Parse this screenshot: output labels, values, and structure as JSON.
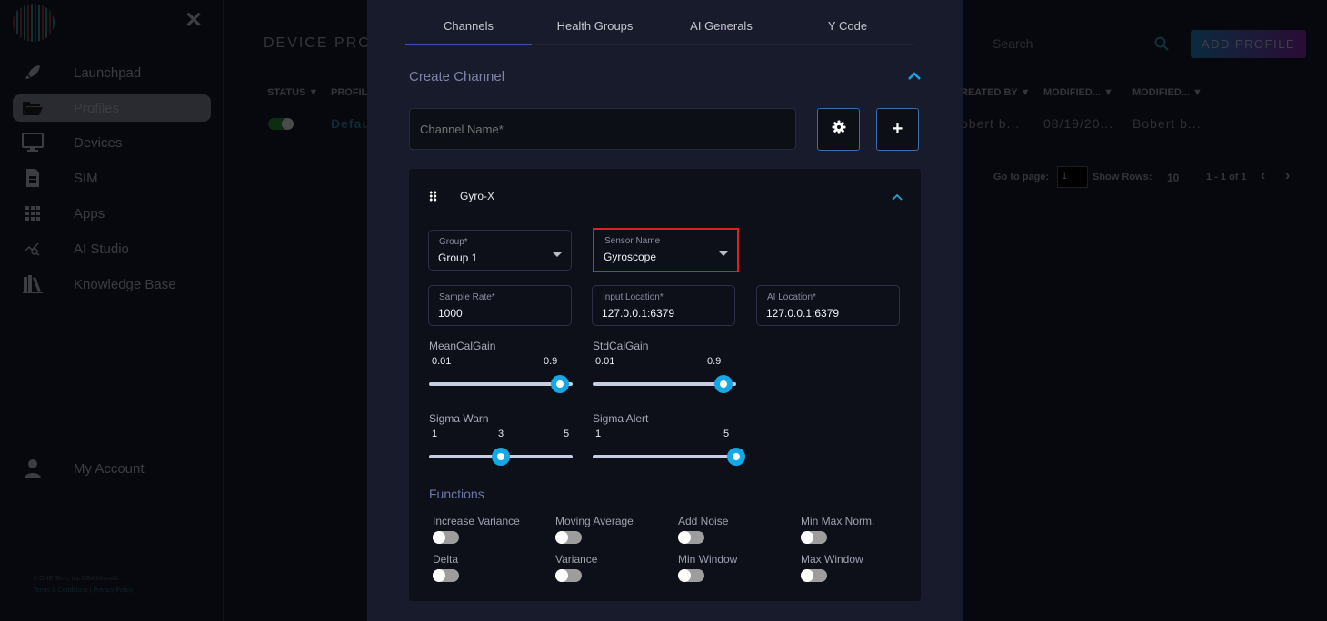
{
  "sidebar": {
    "items": [
      {
        "label": "Launchpad",
        "icon": "rocket-icon",
        "active": false
      },
      {
        "label": "Profiles",
        "icon": "folder-open-icon",
        "active": true
      },
      {
        "label": "Devices",
        "icon": "monitor-icon",
        "active": false
      },
      {
        "label": "SIM",
        "icon": "sim-card-icon",
        "active": false
      },
      {
        "label": "Apps",
        "icon": "grid-icon",
        "active": false
      },
      {
        "label": "AI Studio",
        "icon": "chart-search-icon",
        "active": false
      },
      {
        "label": "Knowledge Base",
        "icon": "books-icon",
        "active": false
      }
    ],
    "account": {
      "label": "My Account",
      "icon": "user-icon"
    },
    "footer": {
      "copyright": "© ONE Tech, Inc DBA MicroAI",
      "terms": "Terms & Conditions",
      "separator": "|",
      "privacy": "Privacy Policy"
    },
    "close_symbol": "✕"
  },
  "background_page": {
    "title": "DEVICE PRO",
    "columns": [
      "STATUS",
      "PROFIL",
      "REATED BY",
      "MODIFIED...",
      "MODIFIED..."
    ],
    "row": {
      "profile": "Defau",
      "created_by": "obert b...",
      "modified_date": "08/19/20...",
      "modified_by": "Bobert b..."
    },
    "search_placeholder": "Search",
    "add_profile": "ADD PROFILE",
    "pager": {
      "go_to_label": "Go to page:",
      "page_value": "1",
      "show_rows_label": "Show Rows:",
      "rows_value": "10",
      "range": "1 - 1 of 1",
      "prev": "‹",
      "next": "›"
    }
  },
  "modal": {
    "tabs": [
      {
        "label": "Channels",
        "active": true
      },
      {
        "label": "Health Groups",
        "active": false
      },
      {
        "label": "AI Generals",
        "active": false
      },
      {
        "label": "Y Code",
        "active": false
      }
    ],
    "create_channel": {
      "title": "Create Channel",
      "channel_name_placeholder": "Channel Name*",
      "settings_symbol": "⚙",
      "add_symbol": "+"
    },
    "channel_card": {
      "title": "Gyro-X",
      "fields": {
        "group": {
          "label": "Group*",
          "value": "Group 1"
        },
        "sensor_name": {
          "label": "Sensor Name",
          "value": "Gyroscope"
        },
        "sample_rate": {
          "label": "Sample Rate*",
          "value": "1000"
        },
        "input_location": {
          "label": "Input Location*",
          "value": "127.0.0.1:6379"
        },
        "ai_location": {
          "label": "AI Location*",
          "value": "127.0.0.1:6379"
        }
      },
      "sliders": {
        "mean_cal_gain": {
          "label": "MeanCalGain",
          "min_label": "0.01",
          "value_label": "0.9",
          "fraction": 0.91
        },
        "std_cal_gain": {
          "label": "StdCalGain",
          "min_label": "0.01",
          "value_label": "0.9",
          "fraction": 0.91
        },
        "sigma_warn": {
          "label": "Sigma Warn",
          "min_label": "1",
          "value_label": "3",
          "max_label": "5",
          "fraction": 0.5
        },
        "sigma_alert": {
          "label": "Sigma Alert",
          "min_label": "1",
          "value_label": "5",
          "fraction": 1.0
        }
      },
      "functions": {
        "title": "Functions",
        "items": [
          {
            "label": "Increase Variance",
            "on": false
          },
          {
            "label": "Moving Average",
            "on": false
          },
          {
            "label": "Add Noise",
            "on": false
          },
          {
            "label": "Min Max Norm.",
            "on": false
          },
          {
            "label": "Delta",
            "on": false
          },
          {
            "label": "Variance",
            "on": false
          },
          {
            "label": "Min Window",
            "on": false
          },
          {
            "label": "Max Window",
            "on": false
          }
        ]
      }
    }
  },
  "colors": {
    "accent": "#14a8e6",
    "tab_indicator": "#3f51b5",
    "highlight_box": "#e0201c",
    "modal_bg": "#181b2b",
    "card_bg": "#0d0f19"
  }
}
